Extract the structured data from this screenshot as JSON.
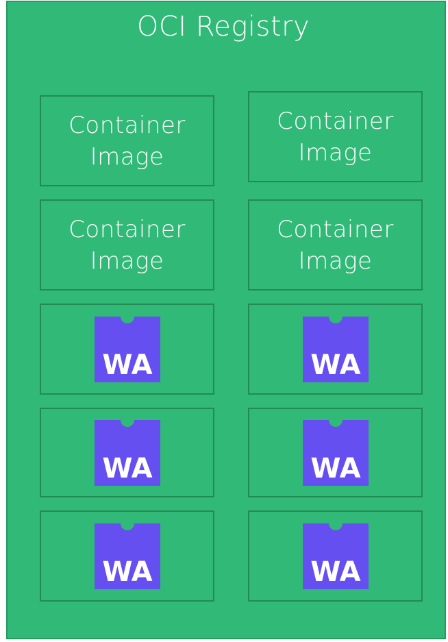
{
  "registry": {
    "title": "OCI Registry"
  },
  "artifacts": [
    {
      "type": "container",
      "label": "Container\nImage"
    },
    {
      "type": "container",
      "label": "Container\nImage"
    },
    {
      "type": "container",
      "label": "Container\nImage"
    },
    {
      "type": "container",
      "label": "Container\nImage"
    },
    {
      "type": "wasm",
      "logo_text": "WA"
    },
    {
      "type": "wasm",
      "logo_text": "WA"
    },
    {
      "type": "wasm",
      "logo_text": "WA"
    },
    {
      "type": "wasm",
      "logo_text": "WA"
    },
    {
      "type": "wasm",
      "logo_text": "WA"
    },
    {
      "type": "wasm",
      "logo_text": "WA"
    }
  ],
  "colors": {
    "registry_fill": "#31b977",
    "registry_border": "#279a60",
    "box_border": "#248a55",
    "wasm_logo": "#654ff0",
    "text": "#ffffff"
  },
  "icons": {
    "wasm": "webassembly-logo-icon"
  }
}
